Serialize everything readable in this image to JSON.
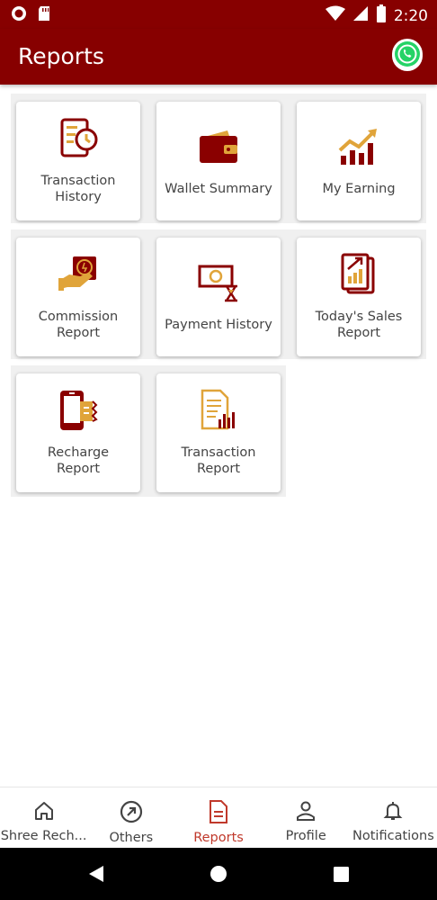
{
  "status_bar": {
    "time": "2:20",
    "icons": [
      "record-icon",
      "sd-card-icon",
      "wifi-icon",
      "signal-icon",
      "battery-icon"
    ]
  },
  "app_bar": {
    "title": "Reports",
    "action_icon": "whatsapp-icon"
  },
  "colors": {
    "primary": "#870000",
    "accent_gold": "#e0a43a",
    "active_nav": "#c0392b"
  },
  "tiles": [
    {
      "label": "Transaction\nHistory",
      "icon": "transaction-history-icon"
    },
    {
      "label": "Wallet Summary",
      "icon": "wallet-icon"
    },
    {
      "label": "My Earning",
      "icon": "earning-chart-icon"
    },
    {
      "label": "Commission\nReport",
      "icon": "commission-hand-icon"
    },
    {
      "label": "Payment History",
      "icon": "payment-cash-icon"
    },
    {
      "label": "Today's Sales\nReport",
      "icon": "sales-report-icon"
    },
    {
      "label": "Recharge\nReport",
      "icon": "mobile-recharge-icon"
    },
    {
      "label": "Transaction\nReport",
      "icon": "transaction-report-icon"
    }
  ],
  "bottom_nav": {
    "items": [
      {
        "label": "Shree Rech...",
        "icon": "home-icon",
        "active": false
      },
      {
        "label": "Others",
        "icon": "compass-icon",
        "active": false
      },
      {
        "label": "Reports",
        "icon": "document-icon",
        "active": true
      },
      {
        "label": "Profile",
        "icon": "person-icon",
        "active": false
      },
      {
        "label": "Notifications",
        "icon": "bell-icon",
        "active": false
      }
    ]
  },
  "system_nav": [
    "back-icon",
    "home-circle-icon",
    "recents-icon"
  ]
}
